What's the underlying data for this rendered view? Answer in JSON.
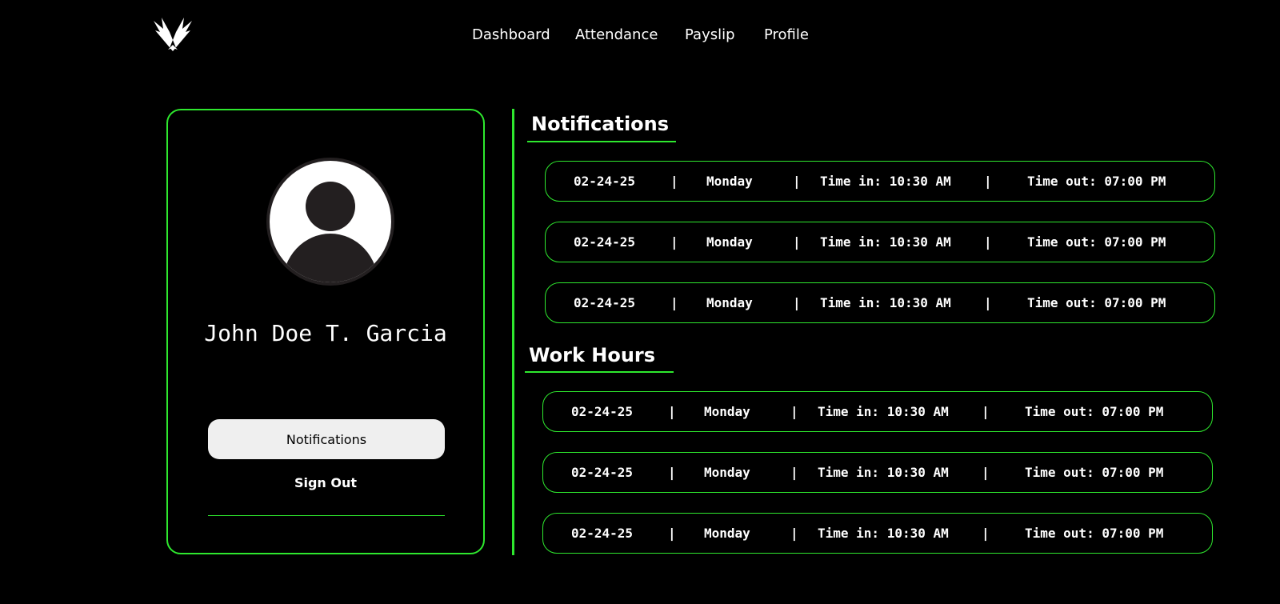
{
  "nav": {
    "items": [
      {
        "label": "Dashboard"
      },
      {
        "label": "Attendance"
      },
      {
        "label": "Payslip"
      },
      {
        "label": "Profile"
      }
    ]
  },
  "profile": {
    "name": "John Doe T. Garcia",
    "notifications_button": "Notifications",
    "sign_out": "Sign Out"
  },
  "notifications": {
    "title": "Notifications",
    "rows": [
      {
        "date": "02-24-25",
        "sep": "|",
        "day": "Monday",
        "time_in": "Time in: 10:30 AM",
        "time_out": "Time out: 07:00 PM"
      },
      {
        "date": "02-24-25",
        "sep": "|",
        "day": "Monday",
        "time_in": "Time in: 10:30 AM",
        "time_out": "Time out: 07:00 PM"
      },
      {
        "date": "02-24-25",
        "sep": "|",
        "day": "Monday",
        "time_in": "Time in: 10:30 AM",
        "time_out": "Time out: 07:00 PM"
      }
    ]
  },
  "work_hours": {
    "title": "Work Hours",
    "rows": [
      {
        "date": "02-24-25",
        "sep": "|",
        "day": "Monday",
        "time_in": "Time in: 10:30 AM",
        "time_out": "Time out: 07:00 PM"
      },
      {
        "date": "02-24-25",
        "sep": "|",
        "day": "Monday",
        "time_in": "Time in: 10:30 AM",
        "time_out": "Time out: 07:00 PM"
      },
      {
        "date": "02-24-25",
        "sep": "|",
        "day": "Monday",
        "time_in": "Time in: 10:30 AM",
        "time_out": "Time out: 07:00 PM"
      }
    ]
  },
  "icons": {
    "logo": "winged-logo-icon",
    "avatar": "user-avatar-icon"
  },
  "colors": {
    "background": "#000000",
    "accent": "#2ee82e",
    "text": "#ffffff",
    "button_bg": "#efefef"
  }
}
